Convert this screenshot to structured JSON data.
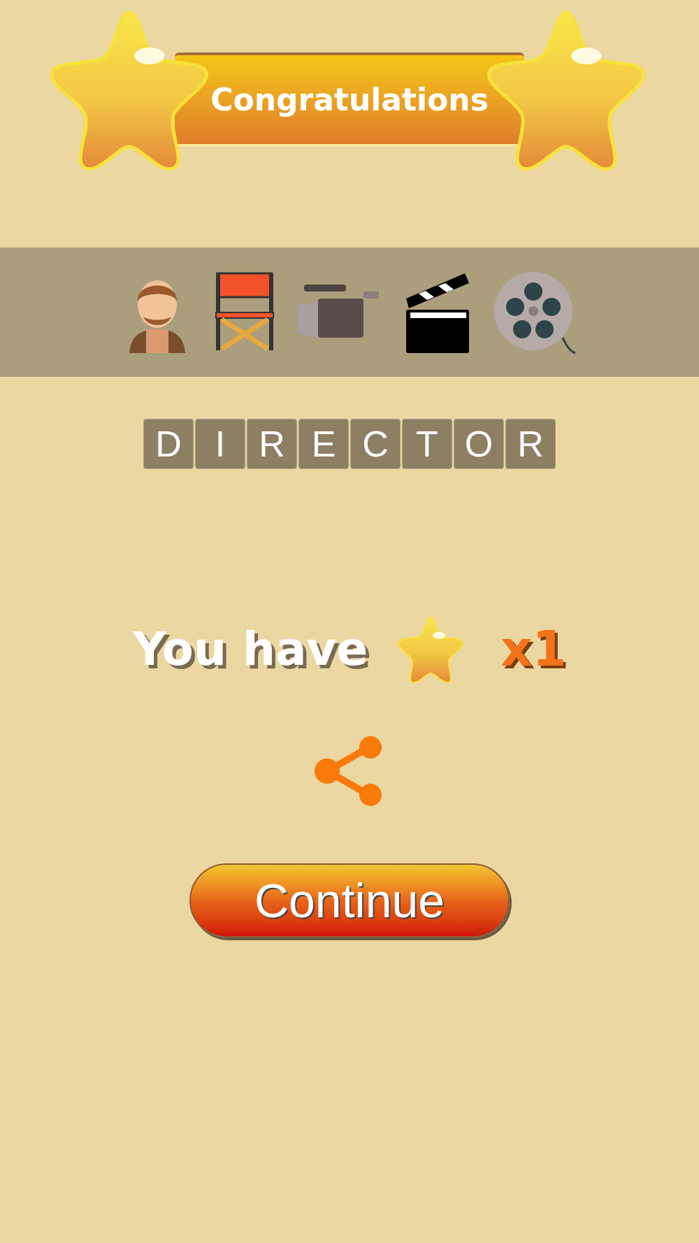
{
  "banner": {
    "title": "Congratulations"
  },
  "answer": {
    "letters": [
      "D",
      "I",
      "R",
      "E",
      "C",
      "T",
      "O",
      "R"
    ]
  },
  "reward": {
    "label": "You have",
    "count": "x1"
  },
  "continue_button": {
    "label": "Continue"
  }
}
